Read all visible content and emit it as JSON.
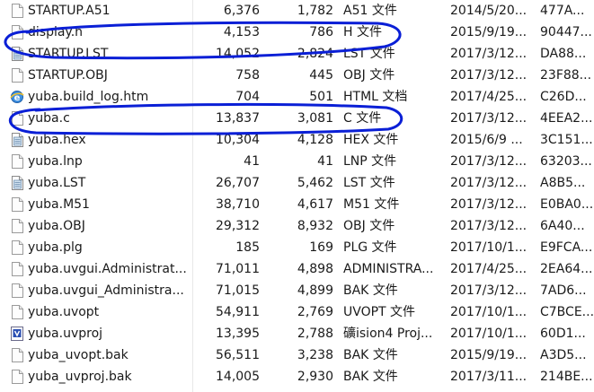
{
  "colors": {
    "text": "#1a1a1a",
    "highlight_pen": "#0a1fd6"
  },
  "files": [
    {
      "name": "STARTUP.A51",
      "icon": "blank-file-icon",
      "size": "6,376",
      "packed": "1,782",
      "type": "A51 文件",
      "date": "2014/5/20...",
      "crc": "477A..."
    },
    {
      "name": "display.h",
      "icon": "blank-file-icon",
      "size": "4,153",
      "packed": "786",
      "type": "H 文件",
      "date": "2015/9/19...",
      "crc": "90447..."
    },
    {
      "name": "STARTUP.LST",
      "icon": "text-file-icon",
      "size": "14,052",
      "packed": "2,824",
      "type": "LST 文件",
      "date": "2017/3/12...",
      "crc": "DA88..."
    },
    {
      "name": "STARTUP.OBJ",
      "icon": "blank-file-icon",
      "size": "758",
      "packed": "445",
      "type": "OBJ 文件",
      "date": "2017/3/12...",
      "crc": "23F88..."
    },
    {
      "name": "yuba.build_log.htm",
      "icon": "ie-html-icon",
      "size": "704",
      "packed": "501",
      "type": "HTML 文档",
      "date": "2017/4/25...",
      "crc": "C26D..."
    },
    {
      "name": "yuba.c",
      "icon": "blank-file-icon",
      "size": "13,837",
      "packed": "3,081",
      "type": "C 文件",
      "date": "2017/3/12...",
      "crc": "4EEA2..."
    },
    {
      "name": "yuba.hex",
      "icon": "text-file-icon",
      "size": "10,304",
      "packed": "4,128",
      "type": "HEX 文件",
      "date": "2015/6/9 ...",
      "crc": "3C151..."
    },
    {
      "name": "yuba.lnp",
      "icon": "blank-file-icon",
      "size": "41",
      "packed": "41",
      "type": "LNP 文件",
      "date": "2017/3/12...",
      "crc": "63203..."
    },
    {
      "name": "yuba.LST",
      "icon": "text-file-icon",
      "size": "26,707",
      "packed": "5,462",
      "type": "LST 文件",
      "date": "2017/3/12...",
      "crc": "A8B5..."
    },
    {
      "name": "yuba.M51",
      "icon": "blank-file-icon",
      "size": "38,710",
      "packed": "4,617",
      "type": "M51 文件",
      "date": "2017/3/12...",
      "crc": "E0BA0..."
    },
    {
      "name": "yuba.OBJ",
      "icon": "blank-file-icon",
      "size": "29,312",
      "packed": "8,932",
      "type": "OBJ 文件",
      "date": "2017/3/12...",
      "crc": "6A40..."
    },
    {
      "name": "yuba.plg",
      "icon": "blank-file-icon",
      "size": "185",
      "packed": "169",
      "type": "PLG 文件",
      "date": "2017/10/1...",
      "crc": "E9FCA..."
    },
    {
      "name": "yuba.uvgui.Administrat...",
      "icon": "blank-file-icon",
      "size": "71,011",
      "packed": "4,898",
      "type": "ADMINISTRA...",
      "date": "2017/4/25...",
      "crc": "2EA64..."
    },
    {
      "name": "yuba.uvgui_Administra...",
      "icon": "blank-file-icon",
      "size": "71,015",
      "packed": "4,899",
      "type": "BAK 文件",
      "date": "2017/3/12...",
      "crc": "7AD6..."
    },
    {
      "name": "yuba.uvopt",
      "icon": "blank-file-icon",
      "size": "54,911",
      "packed": "2,769",
      "type": "UVOPT 文件",
      "date": "2017/10/1...",
      "crc": "C7BCE..."
    },
    {
      "name": "yuba.uvproj",
      "icon": "uvision-project-icon",
      "size": "13,395",
      "packed": "2,788",
      "type": "礦ision4 Proj...",
      "date": "2017/10/1...",
      "crc": "60D1..."
    },
    {
      "name": "yuba_uvopt.bak",
      "icon": "blank-file-icon",
      "size": "56,511",
      "packed": "3,238",
      "type": "BAK 文件",
      "date": "2015/9/19...",
      "crc": "A3D5..."
    },
    {
      "name": "yuba_uvproj.bak",
      "icon": "blank-file-icon",
      "size": "14,005",
      "packed": "2,930",
      "type": "BAK 文件",
      "date": "2017/3/11...",
      "crc": "214BE..."
    }
  ]
}
